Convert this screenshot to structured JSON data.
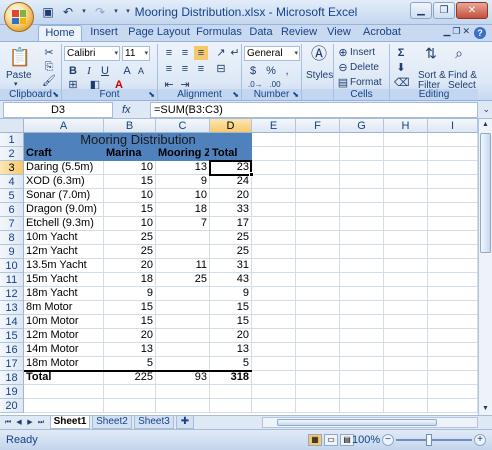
{
  "window": {
    "title": "Mooring Distribution.xlsx - Microsoft Excel"
  },
  "qat": {
    "save_icon": "save-icon",
    "undo_icon": "undo-icon",
    "redo_icon": "redo-icon"
  },
  "tabs": [
    "Home",
    "Insert",
    "Page Layout",
    "Formulas",
    "Data",
    "Review",
    "View",
    "Acrobat"
  ],
  "ribbon": {
    "clipboard": {
      "label": "Clipboard",
      "paste": "Paste"
    },
    "font": {
      "label": "Font",
      "name": "Calibri",
      "size": "11",
      "bold": "B",
      "italic": "I",
      "underline": "U"
    },
    "alignment": {
      "label": "Alignment"
    },
    "number": {
      "label": "Number",
      "format": "General",
      "currency": "$",
      "percent": "%",
      "comma": ","
    },
    "styles": {
      "label": "",
      "button": "Styles"
    },
    "cells": {
      "label": "Cells",
      "insert": "Insert",
      "delete": "Delete",
      "format": "Format"
    },
    "editing": {
      "label": "Editing",
      "sigma": "Σ",
      "sort": "Sort &",
      "sort2": "Filter",
      "find": "Find &",
      "find2": "Select"
    }
  },
  "formula_bar": {
    "name_box": "D3",
    "fx": "fx",
    "formula": "=SUM(B3:C3)"
  },
  "columns": [
    "A",
    "B",
    "C",
    "D",
    "E",
    "F",
    "G",
    "H",
    "I"
  ],
  "rows": [
    "1",
    "2",
    "3",
    "4",
    "5",
    "6",
    "7",
    "8",
    "9",
    "10",
    "11",
    "12",
    "13",
    "14",
    "15",
    "16",
    "17",
    "18",
    "19",
    "20"
  ],
  "sheet": {
    "title": "Mooring Distribution",
    "headers": [
      "Craft",
      "Marina",
      "Mooring Zo",
      "Total"
    ],
    "data": [
      [
        "Daring (5.5m)",
        "10",
        "13",
        "23"
      ],
      [
        "XOD (6.3m)",
        "15",
        "9",
        "24"
      ],
      [
        "Sonar (7.0m)",
        "10",
        "10",
        "20"
      ],
      [
        "Dragon (9.0m)",
        "15",
        "18",
        "33"
      ],
      [
        "Etchell (9.3m)",
        "10",
        "7",
        "17"
      ],
      [
        "10m Yacht",
        "25",
        "",
        "25"
      ],
      [
        "12m Yacht",
        "25",
        "",
        "25"
      ],
      [
        "13.5m Yacht",
        "20",
        "11",
        "31"
      ],
      [
        "15m Yacht",
        "18",
        "25",
        "43"
      ],
      [
        "18m Yacht",
        "9",
        "",
        "9"
      ],
      [
        "8m Motor",
        "15",
        "",
        "15"
      ],
      [
        "10m Motor",
        "15",
        "",
        "15"
      ],
      [
        "12m Motor",
        "20",
        "",
        "20"
      ],
      [
        "14m Motor",
        "13",
        "",
        "13"
      ],
      [
        "18m Motor",
        "5",
        "",
        "5"
      ]
    ],
    "total": [
      "Total",
      "225",
      "93",
      "318"
    ]
  },
  "sheet_tabs": [
    "Sheet1",
    "Sheet2",
    "Sheet3"
  ],
  "status": {
    "text": "Ready",
    "zoom": "100%"
  },
  "colors": {
    "title_fill": "#4f81bd",
    "selection": "#f7c86a",
    "chrome": "#c9d9ef"
  }
}
